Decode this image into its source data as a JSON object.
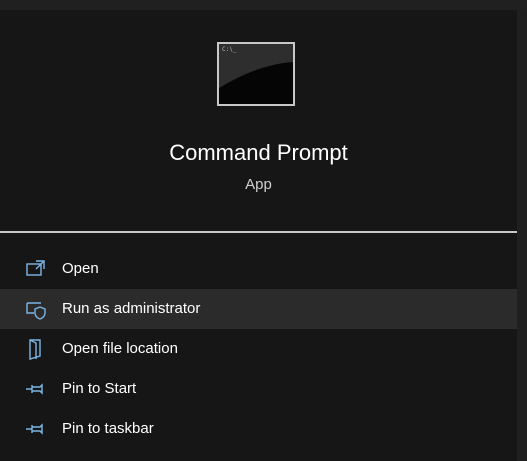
{
  "app": {
    "title": "Command Prompt",
    "type_label": "App",
    "icon": "command-prompt-app-icon",
    "icon_text": "C:\\_"
  },
  "menu": {
    "items": [
      {
        "label": "Open",
        "icon": "open-icon",
        "selected": false
      },
      {
        "label": "Run as administrator",
        "icon": "shield-icon",
        "selected": true
      },
      {
        "label": "Open file location",
        "icon": "file-location-icon",
        "selected": false
      },
      {
        "label": "Pin to Start",
        "icon": "pin-icon",
        "selected": false
      },
      {
        "label": "Pin to taskbar",
        "icon": "pin-icon",
        "selected": false
      }
    ]
  },
  "colors": {
    "background": "#161616",
    "selected_row": "#2b2b2b",
    "icon_accent": "#7cb6e6",
    "text": "#ffffff"
  }
}
